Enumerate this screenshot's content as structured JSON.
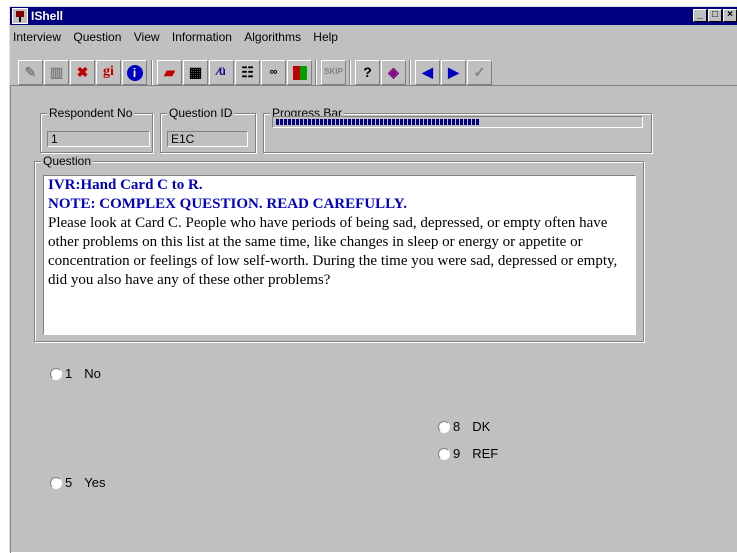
{
  "window": {
    "title": "IShell"
  },
  "menu": [
    "Interview",
    "Question",
    "View",
    "Information",
    "Algorithms",
    "Help"
  ],
  "toolbar": {
    "gi_label": "gi",
    "info_label": "i",
    "prev_label": "◀",
    "next_label": "▶",
    "check_label": "✓"
  },
  "fields": {
    "respondent_label": "Respondent No",
    "respondent_value": "1",
    "question_id_label": "Question ID",
    "question_id_value": "E1C",
    "progress_label": "Progress Bar",
    "progress_fraction": 0.56
  },
  "question": {
    "group_label": "Question",
    "line1": "IVR:Hand Card C to R.",
    "line2": "NOTE: COMPLEX QUESTION. READ CAREFULLY.",
    "body": "Please look at Card C. People who have periods of being sad, depressed, or empty often have other problems on this list at the same time, like changes in sleep or energy or appetite or concentration or feelings of low self-worth.  During the time you were sad, depressed or empty, did you also have any of these other problems?"
  },
  "answers": [
    {
      "code": "1",
      "label": "No"
    },
    {
      "code": "8",
      "label": "DK"
    },
    {
      "code": "9",
      "label": "REF"
    },
    {
      "code": "5",
      "label": "Yes"
    }
  ]
}
